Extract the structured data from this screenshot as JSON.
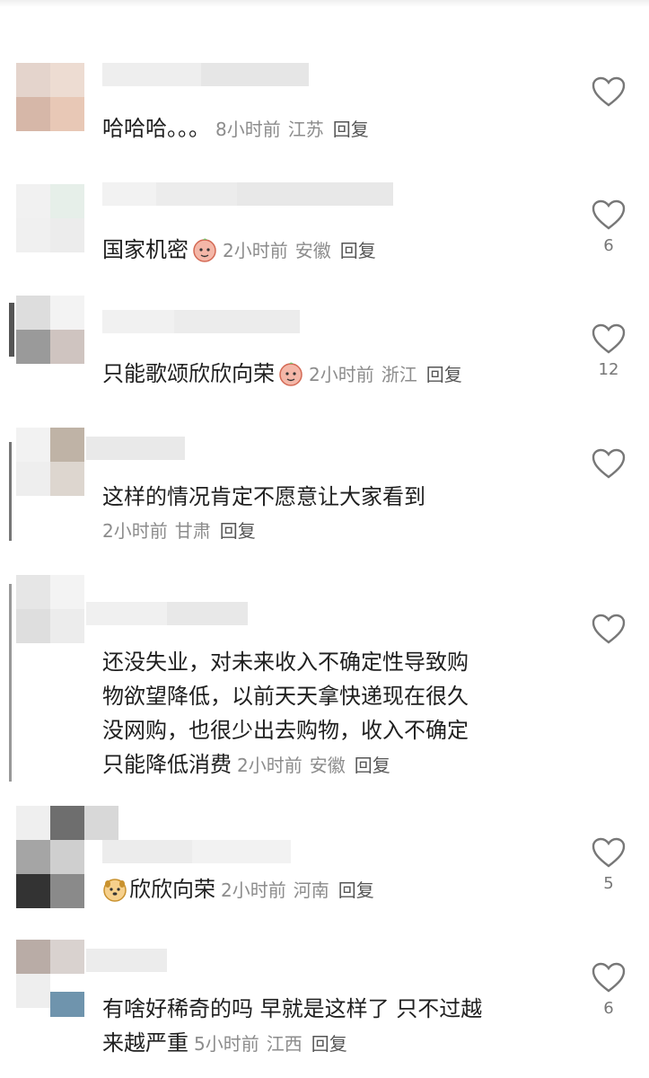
{
  "comments": [
    {
      "text": "哈哈哈。。。",
      "time": "8小时前",
      "location": "江苏",
      "reply": "回复",
      "likes": "",
      "emoji": ""
    },
    {
      "text": "国家机密",
      "time": "2小时前",
      "location": "安徽",
      "reply": "回复",
      "likes": "6",
      "emoji": "face-emoji"
    },
    {
      "text": "只能歌颂欣欣向荣",
      "time": "2小时前",
      "location": "浙江",
      "reply": "回复",
      "likes": "12",
      "emoji": "face-emoji"
    },
    {
      "text": "这样的情况肯定不愿意让大家看到",
      "time": "2小时前",
      "location": "甘肃",
      "reply": "回复",
      "likes": "",
      "emoji": ""
    },
    {
      "text": "还没失业，对未来收入不确定性导致购物欲望降低，以前天天拿快递现在很久没网购，也很少出去购物，收入不确定只能降低消费",
      "time": "2小时前",
      "location": "安徽",
      "reply": "回复",
      "likes": "",
      "emoji": ""
    },
    {
      "text": "欣欣向荣",
      "time": "2小时前",
      "location": "河南",
      "reply": "回复",
      "likes": "5",
      "emoji": "dog-emoji"
    },
    {
      "text": "有啥好稀奇的吗 早就是这样了 只不过越来越严重",
      "time": "5小时前",
      "location": "江西",
      "reply": "回复",
      "likes": "6",
      "emoji": ""
    }
  ],
  "icons": {
    "like": "heart-outline-icon"
  }
}
